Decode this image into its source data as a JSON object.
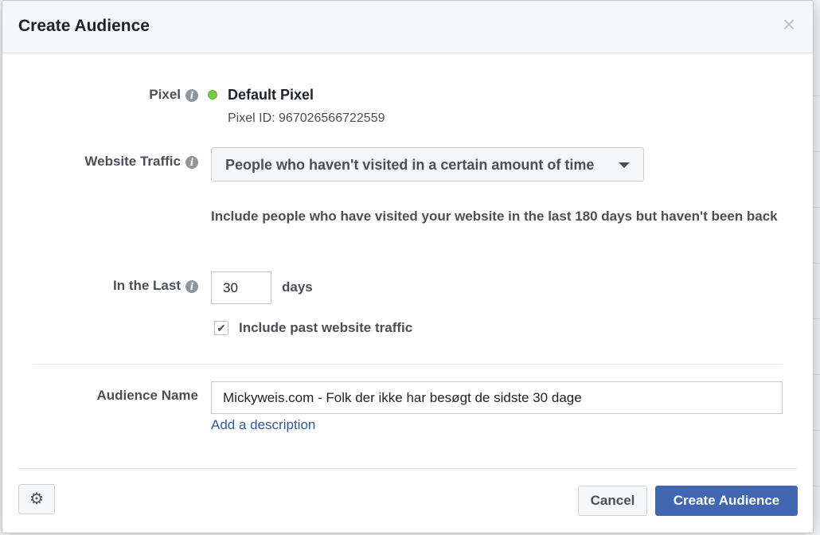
{
  "modal": {
    "title": "Create Audience",
    "close_glyph": "×"
  },
  "pixel": {
    "label": "Pixel",
    "name": "Default Pixel",
    "id_text": "Pixel ID: 967026566722559",
    "status_color": "#7ac943"
  },
  "website_traffic": {
    "label": "Website Traffic",
    "selected": "People who haven't visited in a certain amount of time",
    "description": "Include people who have visited your website in the last 180 days but haven't been back"
  },
  "in_the_last": {
    "label": "In the Last",
    "value": "30",
    "unit": "days"
  },
  "include_past": {
    "label": "Include past website traffic",
    "checked": true,
    "check_glyph": "✔"
  },
  "audience_name": {
    "label": "Audience Name",
    "value": "Mickyweis.com - Folk der ikke har besøgt de sidste 30 dage",
    "add_description": "Add a description"
  },
  "footer": {
    "gear_glyph": "⚙",
    "cancel_label": "Cancel",
    "create_label": "Create Audience"
  },
  "icons": {
    "info_glyph": "i"
  },
  "colors": {
    "primary": "#4267b2",
    "link": "#365899"
  }
}
